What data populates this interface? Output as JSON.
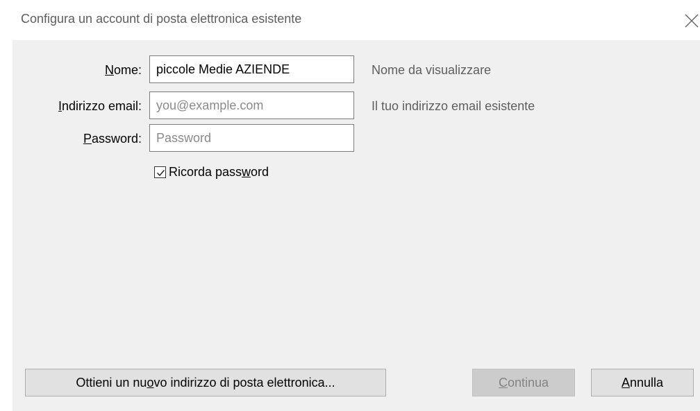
{
  "dialog": {
    "title": "Configura un account di posta elettronica esistente",
    "close_icon": "close-icon"
  },
  "form": {
    "name": {
      "label_pre": "",
      "label_key": "N",
      "label_post": "ome:",
      "value": "piccole Medie AZIENDE",
      "placeholder": "",
      "hint": "Nome da visualizzare"
    },
    "email": {
      "label_pre": "",
      "label_key": "I",
      "label_post": "ndirizzo email:",
      "value": "",
      "placeholder": "you@example.com",
      "hint": "Il tuo indirizzo email esistente"
    },
    "password": {
      "label_pre": "",
      "label_key": "P",
      "label_post": "assword:",
      "value": "",
      "placeholder": "Password"
    },
    "remember": {
      "checked": true,
      "label_pre": "Ricorda pass",
      "label_key": "w",
      "label_post": "ord"
    }
  },
  "buttons": {
    "new_address": {
      "pre": "Ottieni un nu",
      "key": "o",
      "post": "vo indirizzo di posta elettronica..."
    },
    "continue": {
      "pre": "",
      "key": "C",
      "post": "ontinua",
      "disabled": true
    },
    "cancel": {
      "pre": "",
      "key": "A",
      "post": "nnulla"
    }
  },
  "colors": {
    "panel_bg": "#f0f0f0",
    "hint_text": "#5e5e5e",
    "button_bg": "#e1e1e1",
    "button_disabled_bg": "#cccccc"
  }
}
